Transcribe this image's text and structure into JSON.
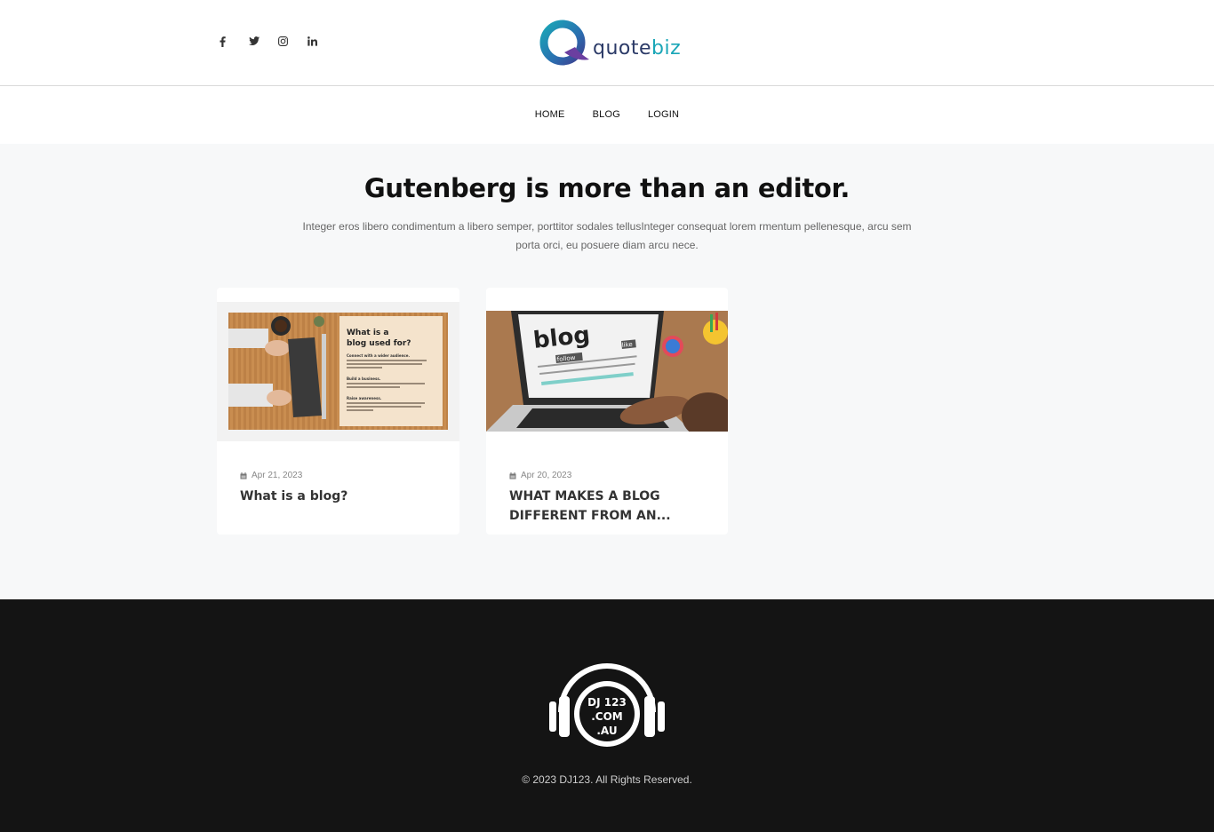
{
  "header": {
    "social": [
      {
        "name": "facebook",
        "glyph": "f"
      },
      {
        "name": "twitter",
        "glyph": "t"
      },
      {
        "name": "instagram",
        "glyph": "ig"
      },
      {
        "name": "linkedin",
        "glyph": "in"
      }
    ],
    "logo": {
      "part1": "quote",
      "part2": "biz"
    }
  },
  "nav": {
    "items": [
      "HOME",
      "BLOG",
      "LOGIN"
    ]
  },
  "hero": {
    "title": "Gutenberg is more than an editor.",
    "description": "Integer eros libero condimentum a libero semper, porttitor sodales tellusInteger consequat lorem rmentum pellenesque, arcu sem porta orci, eu posuere diam arcu nece."
  },
  "posts": [
    {
      "date": "Apr 21, 2023",
      "title": "What is a blog?",
      "image_text": {
        "heading1": "What is a",
        "heading2": "blog used for?",
        "points": [
          "Connect with a wider audience.",
          "Build a business.",
          "Raise awareness."
        ]
      }
    },
    {
      "date": "Apr 20, 2023",
      "title": "WHAT MAKES A BLOG DIFFERENT FROM AN...",
      "image_text": {
        "word": "blog",
        "tag1": "follow",
        "tag2": "like"
      }
    }
  ],
  "footer": {
    "logo_lines": [
      "DJ 123",
      ".COM",
      ".AU"
    ],
    "copyright": "© 2023 DJ123. All Rights Reserved."
  },
  "colors": {
    "brand_dark": "#2b3a67",
    "brand_teal": "#1aa6b7",
    "footer_bg": "#141414",
    "page_bg": "#f7f8f9"
  }
}
